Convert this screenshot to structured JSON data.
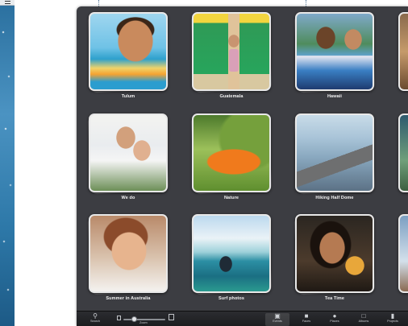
{
  "events": [
    {
      "title": "Tulum",
      "art": "p-tulum"
    },
    {
      "title": "Guatemala",
      "art": "p-guatemala"
    },
    {
      "title": "Hawaii",
      "art": "p-hawaii"
    },
    {
      "title": "We do",
      "art": "p-wedo"
    },
    {
      "title": "Nature",
      "art": "p-nature"
    },
    {
      "title": "Hiking Half Dome",
      "art": "p-hiking"
    },
    {
      "title": "Summer in Australia",
      "art": "p-summer"
    },
    {
      "title": "Surf photos",
      "art": "p-surf"
    },
    {
      "title": "Tea Time",
      "art": "p-tea"
    }
  ],
  "toolbar": {
    "search_label": "Search",
    "zoom_label": "Zoom",
    "zoom_level": 0.25,
    "events_label": "Events",
    "faces_label": "Faces",
    "places_label": "Places",
    "albums_label": "Albums",
    "projects_label": "Projects"
  },
  "icons": {
    "search": "magnifier-icon",
    "events": "events-icon",
    "faces": "faces-icon",
    "places": "globe-icon",
    "albums": "album-icon",
    "projects": "projects-icon"
  },
  "colors": {
    "window_bg": "#3c3d42",
    "toolbar_bg": "#1c1d20",
    "callout": "#5d7f9f"
  }
}
